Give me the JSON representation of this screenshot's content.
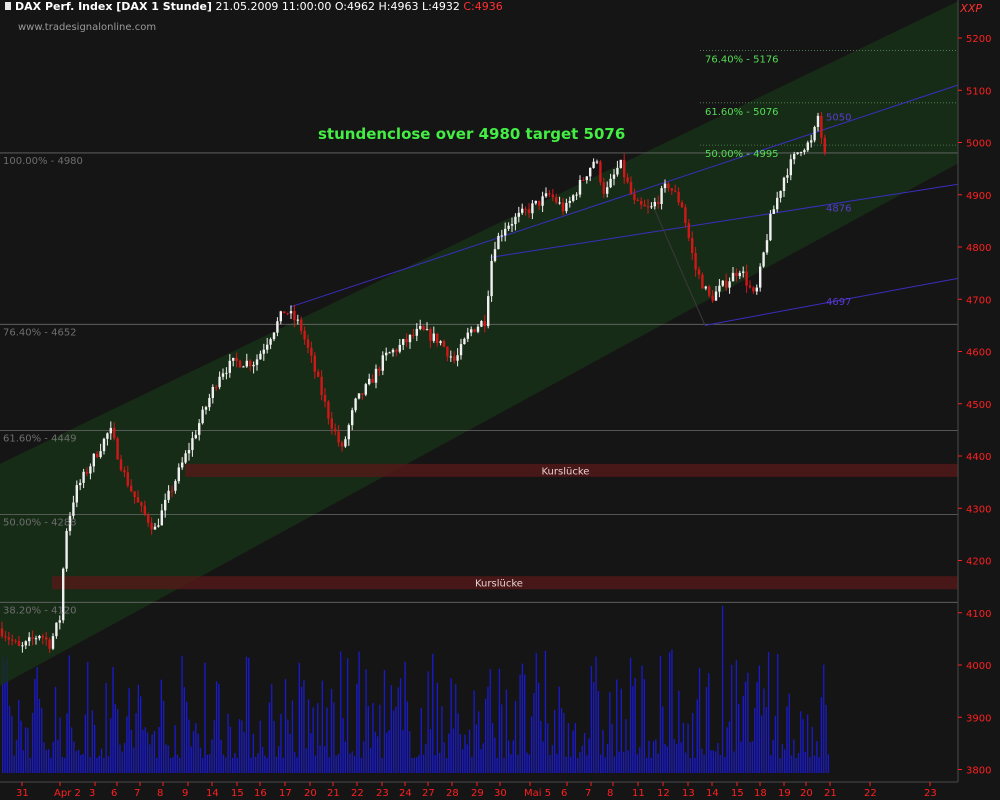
{
  "header": {
    "symbol": "DAX Perf. Index [DAX 1 Stunde]",
    "date": "21.05.2009 11:00:00",
    "open": "O:4962",
    "high": "H:4963",
    "low": "L:4932",
    "close": "C:4936",
    "source": "www.tradesignalonline.com",
    "corner": "XXP"
  },
  "colors": {
    "background": "#151515",
    "channel_fill": "#183018",
    "bull_candle": "#f0f0f0",
    "bear_candle": "#d01818",
    "annotation_green": "#44ee44",
    "axis_red": "#ff2020",
    "channel_line": "#3a2ec0",
    "volume": "#1a1ad0",
    "gap_band": "#5a1818"
  },
  "chart_data": {
    "type": "candlestick",
    "title": "DAX Perf. Index [DAX 1 Stunde]",
    "y_range": [
      3600,
      5250
    ],
    "y_ticks": [
      5200,
      5100,
      5000,
      4900,
      4800,
      4700,
      4600,
      4500,
      4400,
      4300,
      4200,
      4100,
      4000,
      3900,
      3800
    ],
    "x_ticks": [
      "31",
      "Apr 2",
      "3",
      "6",
      "7",
      "8",
      "9",
      "14",
      "15",
      "16",
      "17",
      "20",
      "21",
      "22",
      "23",
      "24",
      "27",
      "28",
      "29",
      "30",
      "Mai 5",
      "6",
      "7",
      "8",
      "11",
      "12",
      "13",
      "14",
      "15",
      "18",
      "19",
      "20",
      "21",
      "22",
      "23"
    ],
    "annotation": "stundenclose over 4980   target 5076",
    "fib_left": [
      {
        "label": "100.00% - 4980",
        "value": 4980
      },
      {
        "label": "76.40% - 4652",
        "value": 4652
      },
      {
        "label": "61.60% - 4449",
        "value": 4449
      },
      {
        "label": "50.00% - 4288",
        "value": 4288
      },
      {
        "label": "38.20% - 4120",
        "value": 4120
      }
    ],
    "fib_right": [
      {
        "label": "76.40% - 5176",
        "value": 5176
      },
      {
        "label": "61.60% - 5076",
        "value": 5076
      },
      {
        "label": "50.00% - 4995",
        "value": 4995
      }
    ],
    "channel_labels": [
      {
        "label": "5050",
        "value": 5050
      },
      {
        "label": "4876",
        "value": 4876
      },
      {
        "label": "4697",
        "value": 4697
      }
    ],
    "gaps": [
      {
        "label": "Kurslücke",
        "from": 4360,
        "to": 4385
      },
      {
        "label": "Kurslücke",
        "from": 4145,
        "to": 4170
      }
    ],
    "close_path": [
      [
        0,
        4070
      ],
      [
        20,
        4030
      ],
      [
        40,
        4060
      ],
      [
        50,
        4040
      ],
      [
        62,
        4100
      ],
      [
        64,
        4240
      ],
      [
        75,
        4330
      ],
      [
        95,
        4400
      ],
      [
        110,
        4450
      ],
      [
        125,
        4360
      ],
      [
        140,
        4300
      ],
      [
        155,
        4260
      ],
      [
        170,
        4330
      ],
      [
        190,
        4420
      ],
      [
        205,
        4490
      ],
      [
        220,
        4560
      ],
      [
        235,
        4580
      ],
      [
        255,
        4580
      ],
      [
        270,
        4630
      ],
      [
        285,
        4680
      ],
      [
        300,
        4650
      ],
      [
        312,
        4580
      ],
      [
        328,
        4480
      ],
      [
        342,
        4410
      ],
      [
        355,
        4500
      ],
      [
        370,
        4540
      ],
      [
        385,
        4590
      ],
      [
        400,
        4610
      ],
      [
        420,
        4640
      ],
      [
        440,
        4620
      ],
      [
        455,
        4580
      ],
      [
        470,
        4640
      ],
      [
        485,
        4660
      ],
      [
        493,
        4800
      ],
      [
        505,
        4840
      ],
      [
        520,
        4860
      ],
      [
        535,
        4880
      ],
      [
        550,
        4900
      ],
      [
        565,
        4870
      ],
      [
        580,
        4920
      ],
      [
        595,
        4970
      ],
      [
        605,
        4900
      ],
      [
        620,
        4960
      ],
      [
        635,
        4880
      ],
      [
        650,
        4870
      ],
      [
        668,
        4920
      ],
      [
        682,
        4880
      ],
      [
        695,
        4760
      ],
      [
        710,
        4700
      ],
      [
        725,
        4730
      ],
      [
        740,
        4760
      ],
      [
        755,
        4700
      ],
      [
        770,
        4850
      ],
      [
        785,
        4940
      ],
      [
        800,
        4990
      ],
      [
        812,
        5000
      ],
      [
        818,
        5050
      ],
      [
        828,
        4936
      ]
    ]
  }
}
